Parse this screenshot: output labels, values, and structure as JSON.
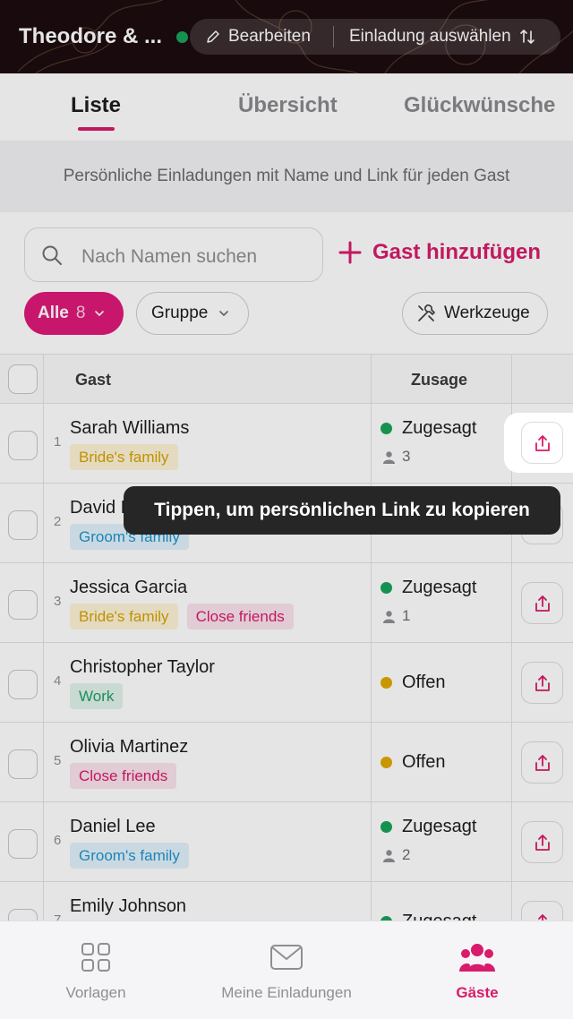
{
  "header": {
    "title": "Theodore & ...",
    "edit_label": "Bearbeiten",
    "invite_select_label": "Einladung auswählen"
  },
  "tabs": [
    {
      "label": "Liste",
      "active": true
    },
    {
      "label": "Übersicht",
      "active": false
    },
    {
      "label": "Glückwünsche",
      "active": false
    }
  ],
  "info_text": "Persönliche Einladungen mit Name und Link für jeden Gast",
  "search": {
    "placeholder": "Nach Namen suchen"
  },
  "add_guest_label": "Gast hinzufügen",
  "filters": {
    "all_label": "Alle",
    "all_count": "8",
    "group_label": "Gruppe",
    "tools_label": "Werkzeuge"
  },
  "table": {
    "col_guest": "Gast",
    "col_rsvp": "Zusage",
    "rows": [
      {
        "num": "1",
        "name": "Sarah Williams",
        "tags": [
          {
            "label": "Bride's family",
            "kind": "bride"
          }
        ],
        "status": "Zugesagt",
        "status_kind": "yes",
        "plus": "3"
      },
      {
        "num": "2",
        "name": "David Lee",
        "tags": [
          {
            "label": "Groom's family",
            "kind": "groom"
          }
        ],
        "status": "",
        "status_kind": "",
        "plus": ""
      },
      {
        "num": "3",
        "name": "Jessica Garcia",
        "tags": [
          {
            "label": "Bride's family",
            "kind": "bride"
          },
          {
            "label": "Close friends",
            "kind": "friends"
          }
        ],
        "status": "Zugesagt",
        "status_kind": "yes",
        "plus": "1"
      },
      {
        "num": "4",
        "name": "Christopher Taylor",
        "tags": [
          {
            "label": "Work",
            "kind": "work"
          }
        ],
        "status": "Offen",
        "status_kind": "open",
        "plus": ""
      },
      {
        "num": "5",
        "name": "Olivia Martinez",
        "tags": [
          {
            "label": "Close friends",
            "kind": "friends"
          }
        ],
        "status": "Offen",
        "status_kind": "open",
        "plus": ""
      },
      {
        "num": "6",
        "name": "Daniel Lee",
        "tags": [
          {
            "label": "Groom's family",
            "kind": "groom"
          }
        ],
        "status": "Zugesagt",
        "status_kind": "yes",
        "plus": "2"
      },
      {
        "num": "7",
        "name": "Emily Johnson",
        "tags": [],
        "status": "Zugesagt",
        "status_kind": "yes",
        "plus": ""
      }
    ]
  },
  "tooltip": "Tippen, um persönlichen Link zu kopieren",
  "bottom_nav": [
    {
      "label": "Vorlagen",
      "icon": "templates-grid-icon",
      "active": false
    },
    {
      "label": "Meine Einladungen",
      "icon": "envelope-icon",
      "active": false
    },
    {
      "label": "Gäste",
      "icon": "guests-group-icon",
      "active": true
    }
  ],
  "colors": {
    "accent": "#d81b6a",
    "status_yes": "#18a35a",
    "status_open": "#e0a800",
    "tag_bride_bg": "#fdf3d6",
    "tag_bride_fg": "#d9a200",
    "tag_groom_bg": "#e1f2fb",
    "tag_groom_fg": "#1f95cf",
    "tag_friends_bg": "#fbe3ec",
    "tag_friends_fg": "#d81b6a",
    "tag_work_bg": "#dff3ea",
    "tag_work_fg": "#1e9d6a"
  }
}
